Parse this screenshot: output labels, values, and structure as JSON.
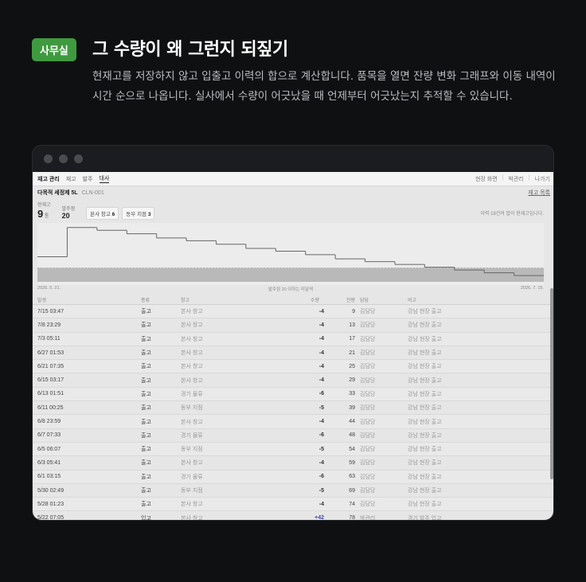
{
  "hero": {
    "badge": "사무실",
    "title": "그 수량이 왜 그런지 되짚기",
    "description": "현재고를 저장하지 않고 입출고 이력의 합으로 계산합니다. 품목을 열면 잔량 변화 그래프와 이동 내역이 시간 순으로 나옵니다. 실사에서 수량이 어긋났을 때 언제부터 어긋났는지 추적할 수 있습니다."
  },
  "app": {
    "nav": {
      "brand": "재고 관리",
      "items": [
        "재고",
        "발주",
        "대사"
      ],
      "active": "대사"
    },
    "top_right": [
      "현장 화면",
      "박관리",
      "나가기"
    ],
    "item": {
      "name": "다목적 세정제 5L",
      "code": "CLN-001",
      "link": "재고 목록"
    },
    "stats": {
      "current_label": "현재고",
      "current_value": "9",
      "current_unit": "통",
      "reorder_label": "발주점",
      "reorder_value": "20",
      "chips": [
        {
          "label": "본사 창고",
          "value": "6"
        },
        {
          "label": "동부 지점",
          "value": "3"
        }
      ],
      "note": "이력 18건의 합이 현재고입니다."
    },
    "chart_axis": {
      "start": "2026. 5. 21.",
      "mid": "발주점 20 이하는 미달색",
      "end": "2026. 7. 15."
    },
    "columns": [
      "발생",
      "종류",
      "창고",
      "수량",
      "잔량",
      "담당",
      "비고"
    ],
    "rows": [
      {
        "when": "7/15 03:47",
        "type": "출고",
        "wh": "본사 창고",
        "qty": "-4",
        "bal": "9",
        "who": "김담당",
        "note": "강남 현장 출고"
      },
      {
        "when": "7/8 23:29",
        "type": "출고",
        "wh": "본사 창고",
        "qty": "-4",
        "bal": "13",
        "who": "김담당",
        "note": "강남 현장 출고"
      },
      {
        "when": "7/3 05:11",
        "type": "출고",
        "wh": "본사 창고",
        "qty": "-4",
        "bal": "17",
        "who": "김담당",
        "note": "강남 현장 출고"
      },
      {
        "when": "6/27 01:53",
        "type": "출고",
        "wh": "본사 창고",
        "qty": "-4",
        "bal": "21",
        "who": "김담당",
        "note": "강남 현장 출고"
      },
      {
        "when": "6/21 07:35",
        "type": "출고",
        "wh": "본사 창고",
        "qty": "-4",
        "bal": "25",
        "who": "김담당",
        "note": "강남 현장 출고"
      },
      {
        "when": "6/15 03:17",
        "type": "출고",
        "wh": "본사 창고",
        "qty": "-4",
        "bal": "29",
        "who": "김담당",
        "note": "강남 현장 출고"
      },
      {
        "when": "6/13 01:51",
        "type": "출고",
        "wh": "경기 물류",
        "qty": "-6",
        "bal": "33",
        "who": "김담당",
        "note": "강남 현장 출고"
      },
      {
        "when": "6/11 00:25",
        "type": "출고",
        "wh": "동부 지점",
        "qty": "-5",
        "bal": "39",
        "who": "김담당",
        "note": "강남 현장 출고"
      },
      {
        "when": "6/8 23:59",
        "type": "출고",
        "wh": "본사 창고",
        "qty": "-4",
        "bal": "44",
        "who": "김담당",
        "note": "강남 현장 출고"
      },
      {
        "when": "6/7 07:33",
        "type": "출고",
        "wh": "경기 물류",
        "qty": "-6",
        "bal": "48",
        "who": "김담당",
        "note": "강남 현장 출고"
      },
      {
        "when": "6/5 06:07",
        "type": "출고",
        "wh": "동부 지점",
        "qty": "-5",
        "bal": "54",
        "who": "김담당",
        "note": "강남 현장 출고"
      },
      {
        "when": "6/3 05:41",
        "type": "출고",
        "wh": "본사 창고",
        "qty": "-4",
        "bal": "59",
        "who": "김담당",
        "note": "강남 현장 출고"
      },
      {
        "when": "6/1 03:15",
        "type": "출고",
        "wh": "경기 물류",
        "qty": "-6",
        "bal": "63",
        "who": "김담당",
        "note": "강남 현장 출고"
      },
      {
        "when": "5/30 02:49",
        "type": "출고",
        "wh": "동부 지점",
        "qty": "-5",
        "bal": "69",
        "who": "김담당",
        "note": "강남 현장 출고"
      },
      {
        "when": "5/28 01:23",
        "type": "출고",
        "wh": "본사 창고",
        "qty": "-4",
        "bal": "74",
        "who": "김담당",
        "note": "강남 현장 출고"
      },
      {
        "when": "5/22 07:05",
        "type": "입고",
        "wh": "본사 창고",
        "qty": "+42",
        "bal": "78",
        "who": "박관리",
        "note": "경기 발주 입고"
      }
    ]
  },
  "chart_data": {
    "type": "line",
    "x_start": "2026. 5. 21.",
    "x_end": "2026. 7. 15.",
    "threshold": 20,
    "step_values": [
      36,
      78,
      74,
      69,
      63,
      59,
      54,
      48,
      44,
      39,
      33,
      29,
      25,
      21,
      17,
      13,
      9
    ],
    "ylim": [
      0,
      80
    ],
    "colors": {
      "line": "#666666",
      "below_threshold": "#b9b9b9"
    }
  }
}
